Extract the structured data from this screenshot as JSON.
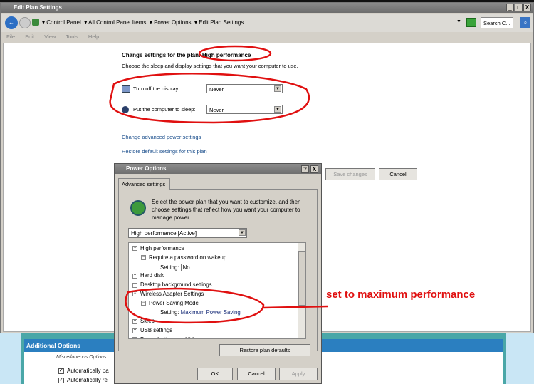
{
  "window": {
    "title": "Edit Plan Settings",
    "min": "_",
    "max": "□",
    "close": "X"
  },
  "address": {
    "crumbs": [
      "Control Panel",
      "All Control Panel Items",
      "Power Options",
      "Edit Plan Settings"
    ],
    "search_placeholder": "Search C..."
  },
  "menu": [
    "File",
    "Edit",
    "View",
    "Tools",
    "Help"
  ],
  "plan": {
    "heading": "Change settings for the plan: High performance",
    "subheading": "Choose the sleep and display settings that you want your computer to use.",
    "display_label": "Turn off the display:",
    "display_value": "Never",
    "sleep_label": "Put the computer to sleep:",
    "sleep_value": "Never",
    "advanced_link": "Change advanced power settings",
    "restore_link": "Restore default settings for this plan",
    "save": "Save changes",
    "cancel": "Cancel"
  },
  "dialog": {
    "title": "Power Options",
    "help": "?",
    "close": "X",
    "tab": "Advanced settings",
    "intro": "Select the power plan that you want to customize, and then choose settings that reflect how you want your computer to manage power.",
    "plan_select": "High performance [Active]",
    "tree": [
      {
        "toggle": "−",
        "label": "High performance",
        "indent": 0
      },
      {
        "toggle": "−",
        "label": "Require a password on wakeup",
        "indent": 1
      },
      {
        "setting_label": "Setting:",
        "setting_value": "No",
        "indent": 2
      },
      {
        "toggle": "+",
        "label": "Hard disk",
        "indent": 0
      },
      {
        "toggle": "+",
        "label": "Desktop background settings",
        "indent": 0
      },
      {
        "toggle": "−",
        "label": "Wireless Adapter Settings",
        "indent": 0
      },
      {
        "toggle": "−",
        "label": "Power Saving Mode",
        "indent": 1
      },
      {
        "setting_label": "Setting:",
        "setting_value": "Maximum Power Saving",
        "indent": 2
      },
      {
        "toggle": "+",
        "label": "Sleep",
        "indent": 0
      },
      {
        "toggle": "+",
        "label": "USB settings",
        "indent": 0
      },
      {
        "toggle": "+",
        "label": "Power buttons and lid",
        "indent": 0
      }
    ],
    "restore": "Restore plan defaults",
    "ok": "OK",
    "cancel": "Cancel",
    "apply": "Apply"
  },
  "annotation": {
    "text": "set to maximum performance",
    "color": "#e01010"
  },
  "additional": {
    "header": "Additional Options",
    "group": "Miscellaneous Options",
    "items": [
      "Automatically pa",
      "Automatically re"
    ]
  }
}
